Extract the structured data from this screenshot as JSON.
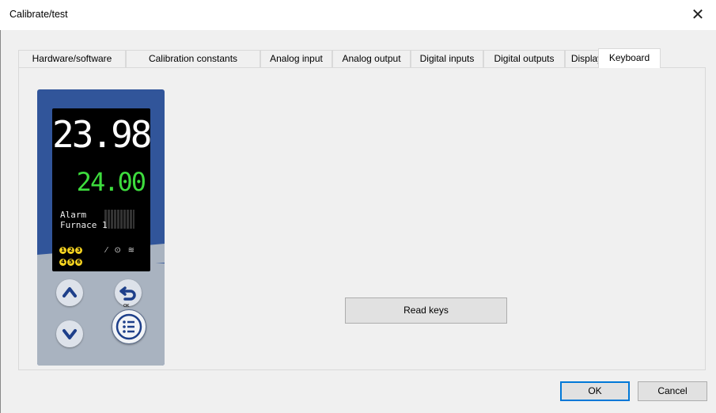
{
  "window": {
    "title": "Calibrate/test",
    "close_glyph": "✕"
  },
  "tabs": [
    {
      "label": "Hardware/software"
    },
    {
      "label": "Calibration constants"
    },
    {
      "label": "Analog input"
    },
    {
      "label": "Analog output"
    },
    {
      "label": "Digital inputs"
    },
    {
      "label": "Digital outputs"
    },
    {
      "label": "Display"
    },
    {
      "label": "Keyboard",
      "active": true
    }
  ],
  "device": {
    "process_value": "23.98",
    "setpoint": "24.00",
    "line1": "Alarm",
    "line2": "Furnace 1",
    "leds": [
      "1",
      "2",
      "3",
      "4",
      "5",
      "6"
    ],
    "status_icons": "⁄ ⊙ ≋",
    "ok_mark": "OK",
    "keys": {
      "up": "up-arrow-icon",
      "back": "back-arrow-icon",
      "down": "down-arrow-icon",
      "menu": "menu-list-icon"
    },
    "colors": {
      "housing": "#31559a",
      "pv": "#ffffff",
      "sp": "#3ddc3d",
      "leds": "#f5d320"
    }
  },
  "buttons": {
    "read_keys": "Read keys",
    "ok": "OK",
    "cancel": "Cancel"
  }
}
